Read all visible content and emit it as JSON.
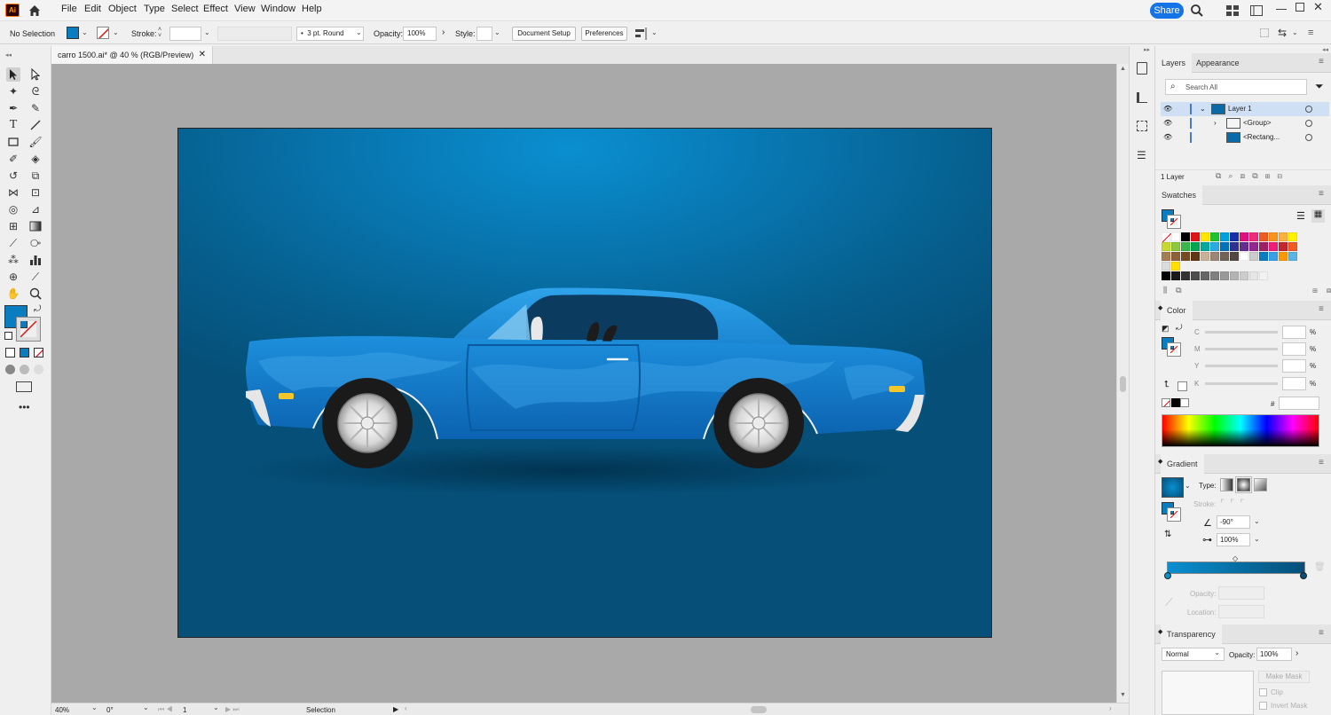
{
  "app": {
    "logo": "Ai"
  },
  "menu": {
    "items": [
      "File",
      "Edit",
      "Object",
      "Type",
      "Select",
      "Effect",
      "View",
      "Window",
      "Help"
    ],
    "share_label": "Share"
  },
  "control_bar": {
    "selection_label": "No Selection",
    "stroke_label": "Stroke:",
    "brush_label": "3 pt. Round",
    "opacity_label": "Opacity:",
    "opacity_value": "100%",
    "style_label": "Style:",
    "document_setup_label": "Document Setup",
    "preferences_label": "Preferences"
  },
  "document": {
    "tab_title": "carro 1500.ai* @ 40 % (RGB/Preview)"
  },
  "colors": {
    "fill": "#0a7cc0",
    "artboard_top": "#0a8fd0",
    "artboard_bottom": "#054f78",
    "share": "#1473e6"
  },
  "status_bar": {
    "zoom": "40%",
    "rotation": "0°",
    "artboard_number": "1",
    "tool_label": "Selection"
  },
  "layers_panel": {
    "tabs": [
      "Layers",
      "Appearance"
    ],
    "search_placeholder": "Search All",
    "rows": [
      {
        "name": "Layer 1"
      },
      {
        "name": "<Group>"
      },
      {
        "name": "<Rectang..."
      }
    ],
    "count_label": "1 Layer"
  },
  "swatches_panel": {
    "title": "Swatches"
  },
  "color_panel": {
    "title": "Color",
    "channels": [
      "C",
      "M",
      "Y",
      "K"
    ],
    "unit": "%",
    "hex_prefix": "#"
  },
  "gradient_panel": {
    "title": "Gradient",
    "type_label": "Type:",
    "stroke_label": "Stroke:",
    "angle_value": "-90°",
    "aspect_value": "100%",
    "opacity_label": "Opacity:",
    "location_label": "Location:"
  },
  "transparency_panel": {
    "title": "Transparency",
    "blend_mode": "Normal",
    "opacity_label": "Opacity:",
    "opacity_value": "100%",
    "make_mask_label": "Make Mask",
    "clip_label": "Clip",
    "invert_mask_label": "Invert Mask"
  }
}
